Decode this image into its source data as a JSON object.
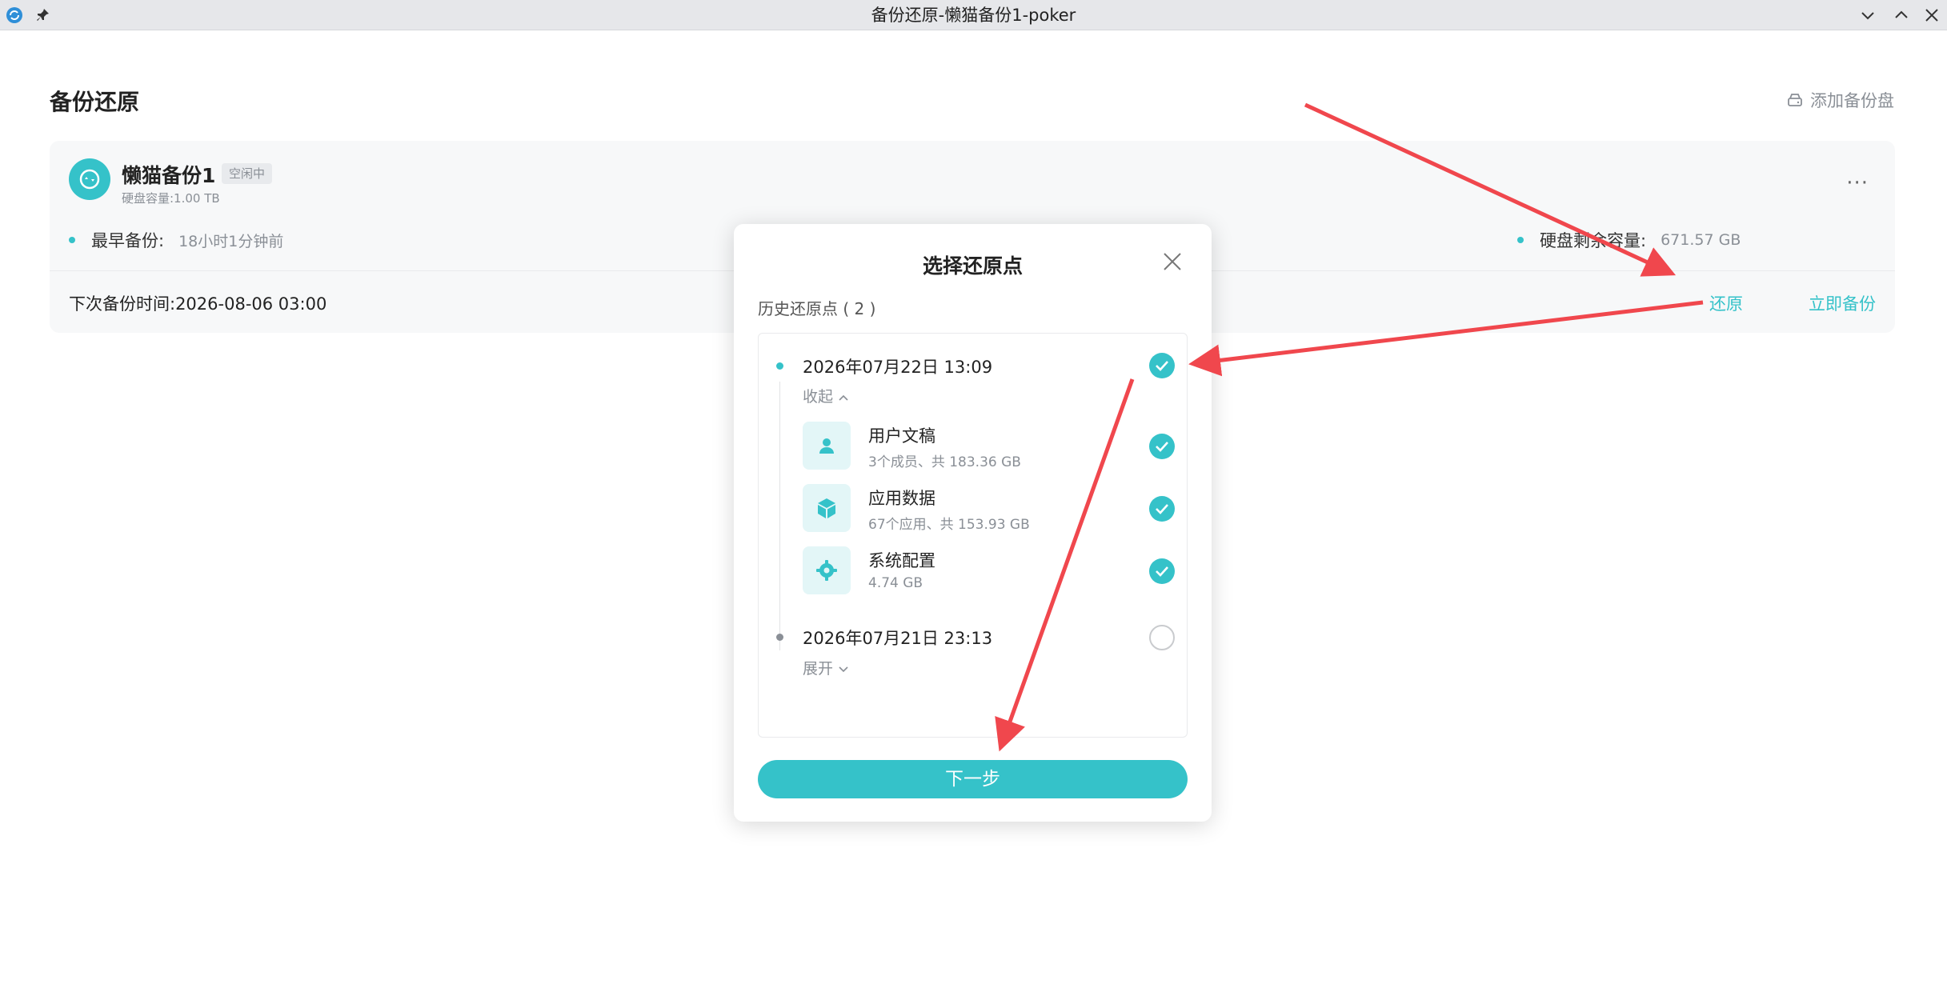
{
  "window": {
    "title": "备份还原-懒猫备份1-poker"
  },
  "page": {
    "title": "备份还原",
    "add_disk": "添加备份盘"
  },
  "card": {
    "name": "懒猫备份1",
    "status": "空闲中",
    "capacity": "硬盘容量:1.00 TB",
    "more": "···",
    "earliest_label": "最早备份:",
    "earliest_value": "18小时1分钟前",
    "remaining_label": "硬盘剩余容量:",
    "remaining_value": "671.57 GB",
    "next_time": "下次备份时间:2026-08-06 03:00",
    "restore": "还原",
    "backup_now": "立即备份"
  },
  "modal": {
    "title": "选择还原点",
    "subtitle": "历史还原点 ( 2 )",
    "points": [
      {
        "date": "2026年07月22日 13:09",
        "toggle": "收起",
        "selected": true,
        "items": [
          {
            "name": "用户文稿",
            "desc": "3个成员、共 183.36 GB",
            "icon": "user-icon",
            "selected": true
          },
          {
            "name": "应用数据",
            "desc": "67个应用、共 153.93 GB",
            "icon": "cube-icon",
            "selected": true
          },
          {
            "name": "系统配置",
            "desc": "4.74 GB",
            "icon": "gear-icon",
            "selected": true
          }
        ]
      },
      {
        "date": "2026年07月21日 23:13",
        "toggle": "展开",
        "selected": false
      }
    ],
    "next_button": "下一步"
  },
  "colors": {
    "accent": "#35c2c9",
    "annotation": "#f0474d"
  }
}
